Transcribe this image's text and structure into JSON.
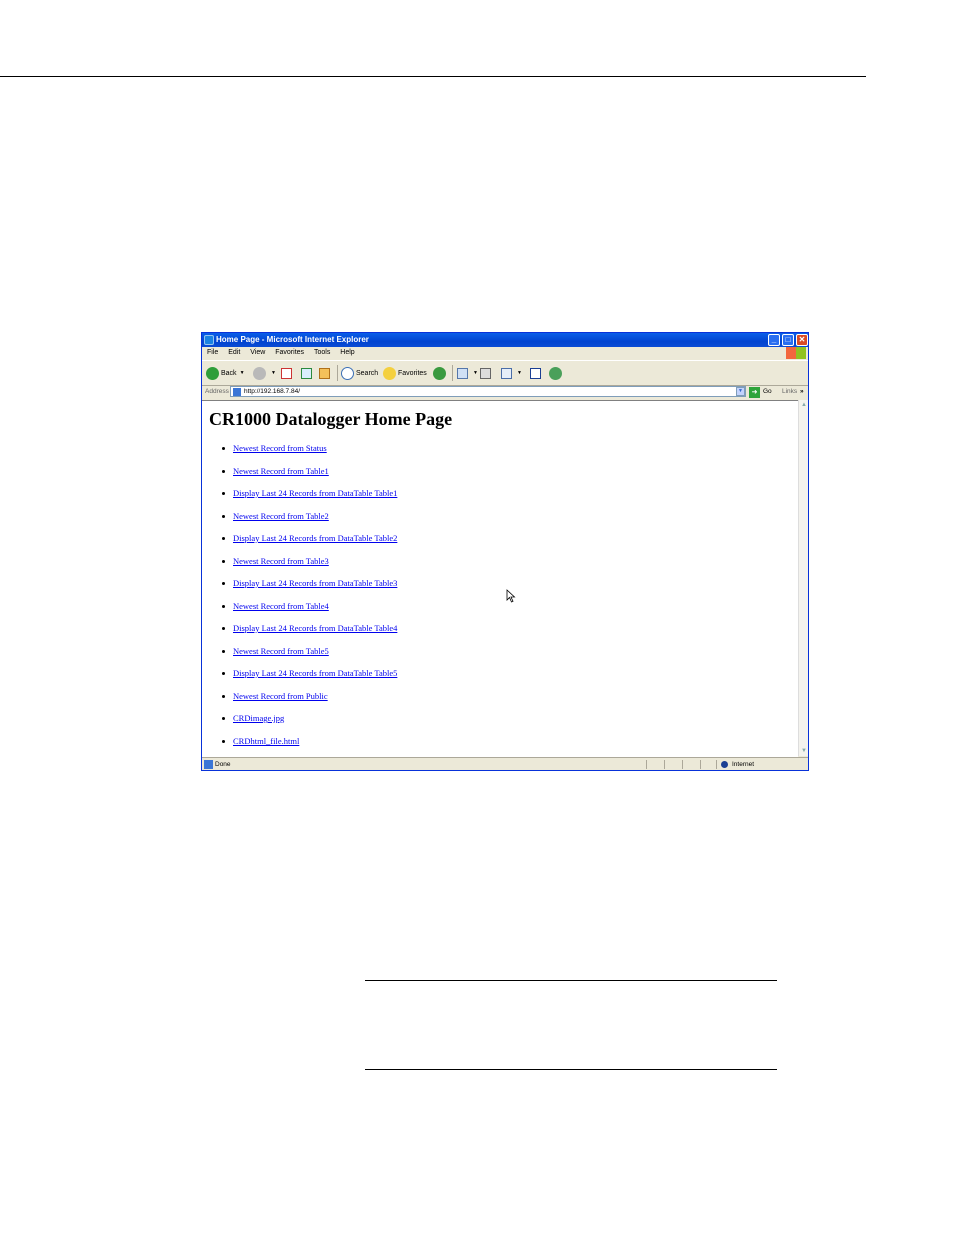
{
  "window": {
    "title": "Home Page - Microsoft Internet Explorer",
    "controls": {
      "minimize": "_",
      "maximize": "□",
      "close": "✕"
    }
  },
  "menu": [
    "File",
    "Edit",
    "View",
    "Favorites",
    "Tools",
    "Help"
  ],
  "toolbar": {
    "back_label": "Back",
    "search_label": "Search",
    "favorites_label": "Favorites"
  },
  "address": {
    "label": "Address",
    "url": "http://192.168.7.84/",
    "go_label": "Go",
    "links_label": "Links",
    "more": "»"
  },
  "page": {
    "heading": "CR1000 Datalogger Home Page",
    "links": [
      "Newest Record from Status",
      "Newest Record from Table1",
      "Display Last 24 Records from DataTable Table1",
      "Newest Record from Table2",
      "Display Last 24 Records from DataTable Table2",
      "Newest Record from Table3",
      "Display Last 24 Records from DataTable Table3",
      "Newest Record from Table4",
      "Display Last 24 Records from DataTable Table4",
      "Newest Record from Table5",
      "Display Last 24 Records from DataTable Table5",
      "Newest Record from Public",
      "CRDimage.jpg",
      "CRDhtml_file.html"
    ]
  },
  "status": {
    "text": "Done",
    "zone": "Internet"
  }
}
